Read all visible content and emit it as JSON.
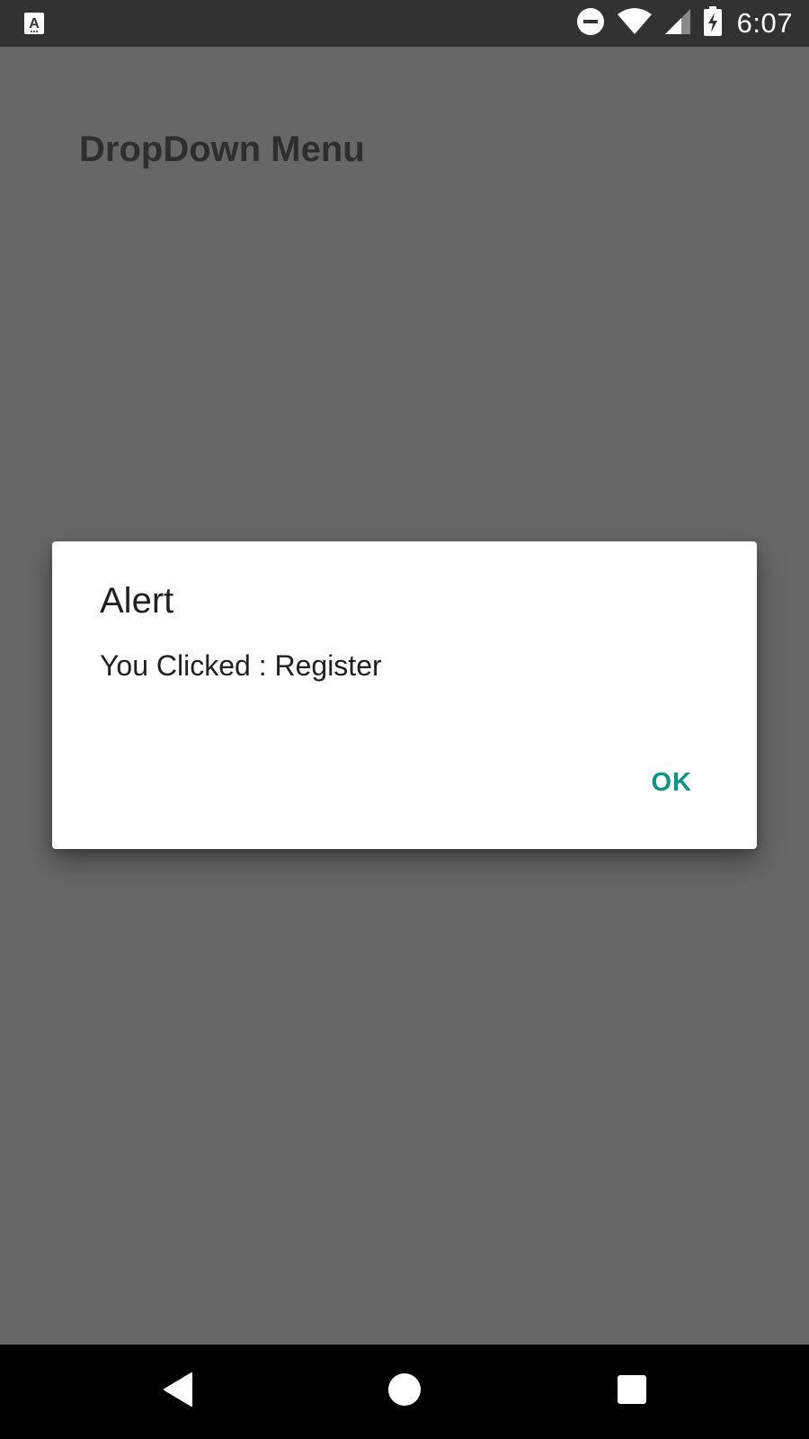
{
  "status_bar": {
    "time": "6:07",
    "app_icon_letter": "A",
    "icons": [
      "app-notification-icon",
      "do-not-disturb-icon",
      "wifi-icon",
      "cell-signal-icon",
      "battery-charging-icon"
    ]
  },
  "app": {
    "title": "DropDown Menu"
  },
  "dialog": {
    "title": "Alert",
    "message": "You Clicked : Register",
    "ok_label": "OK",
    "accent_color": "#0f9385"
  },
  "nav_bar": {
    "icons": [
      "back-icon",
      "home-icon",
      "recents-icon"
    ]
  },
  "colors": {
    "scrim": "#676767",
    "status_bar": "#323232",
    "nav_bar": "#000000",
    "dialog_bg": "#ffffff"
  }
}
